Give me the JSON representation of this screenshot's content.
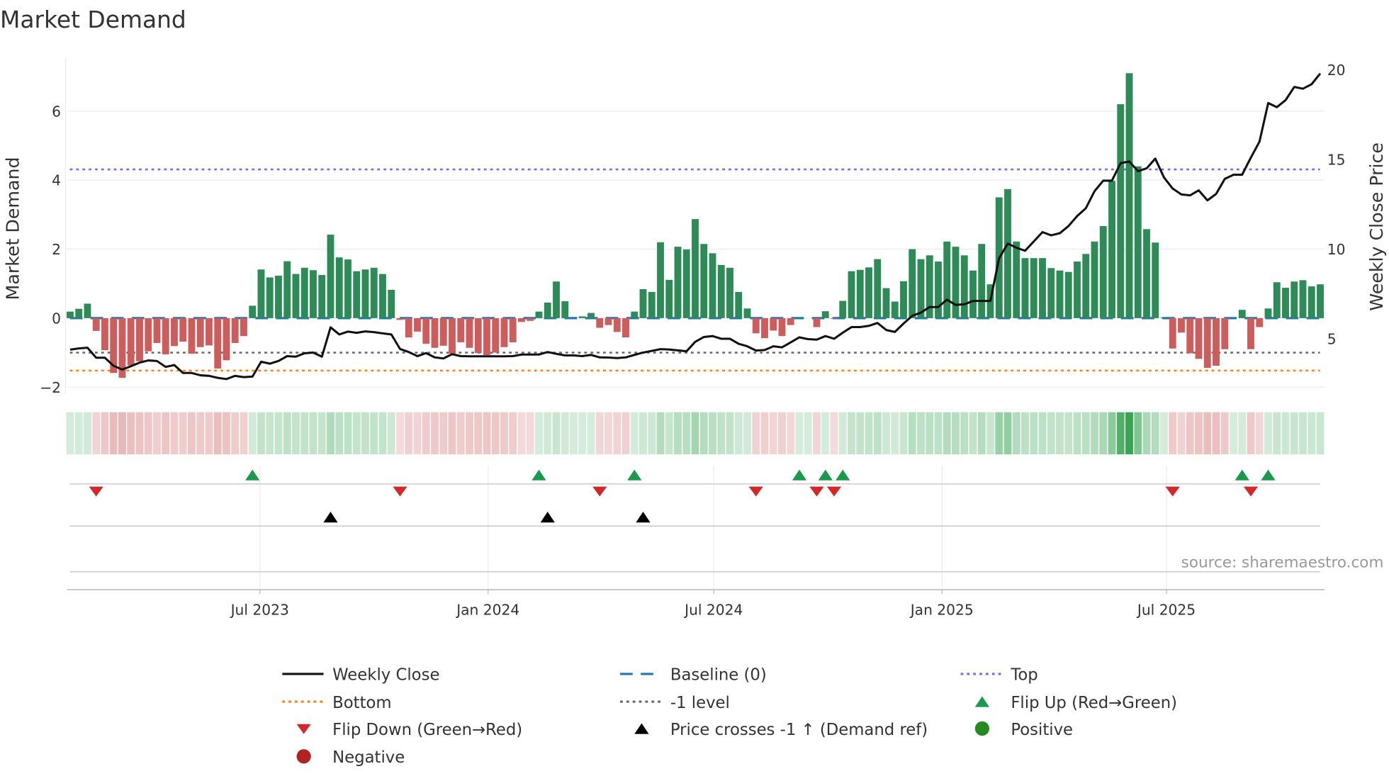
{
  "chart_data": {
    "type": "bar",
    "title": "Market Demand",
    "ylabel": "Market Demand",
    "y2label": "Weekly Close Price",
    "ylim": [
      -2.3,
      7.5
    ],
    "y2lim": [
      2.2,
      21
    ],
    "yticks": [
      "6",
      "4",
      "2",
      "0",
      "−2"
    ],
    "ytick_values": [
      6,
      4,
      2,
      0,
      -2
    ],
    "y2ticks": [
      "20",
      "15",
      "10",
      "5"
    ],
    "y2tick_values": [
      20,
      15,
      10,
      5
    ],
    "xticks": [
      {
        "label": "Jul 2023",
        "date": "2023-07-01"
      },
      {
        "label": "Jan 2024",
        "date": "2024-01-01"
      },
      {
        "label": "Jul 2024",
        "date": "2024-07-01"
      },
      {
        "label": "Jan 2025",
        "date": "2025-01-01"
      },
      {
        "label": "Jul 2025",
        "date": "2025-07-01"
      }
    ],
    "grid": true,
    "x_start": "2023-01-29",
    "x_step_days": 7,
    "demand": [
      0.19,
      0.27,
      0.42,
      -0.37,
      -0.93,
      -1.59,
      -1.73,
      -1.37,
      -1.25,
      -0.96,
      -0.72,
      -1.05,
      -0.81,
      -0.68,
      -1.03,
      -0.84,
      -0.79,
      -1.46,
      -1.22,
      -0.72,
      -0.52,
      0.36,
      1.41,
      1.18,
      1.23,
      1.65,
      1.28,
      1.46,
      1.39,
      1.25,
      2.42,
      1.76,
      1.7,
      1.36,
      1.41,
      1.46,
      1.28,
      0.82,
      -0.05,
      -0.56,
      -0.39,
      -0.74,
      -0.86,
      -0.8,
      -1.03,
      -0.7,
      -0.86,
      -1.01,
      -1.07,
      -1.0,
      -0.84,
      -0.7,
      -0.11,
      -0.08,
      0.19,
      0.45,
      1.06,
      0.49,
      0,
      0.05,
      0.15,
      -0.28,
      -0.2,
      -0.4,
      -0.56,
      0.19,
      0.84,
      0.76,
      2.2,
      1.11,
      2.07,
      1.99,
      2.87,
      2.15,
      1.88,
      1.54,
      1.46,
      0.76,
      0.28,
      -0.44,
      -0.58,
      -0.36,
      -0.52,
      -0.2,
      0.02,
      0,
      -0.26,
      0.2,
      -0.02,
      0.5,
      1.36,
      1.4,
      1.47,
      1.71,
      0.87,
      0.48,
      1.07,
      2.0,
      1.71,
      1.82,
      1.64,
      2.22,
      2.07,
      1.82,
      1.38,
      2.15,
      0.98,
      3.5,
      3.74,
      2.22,
      1.74,
      1.74,
      1.74,
      1.45,
      1.38,
      1.34,
      1.64,
      1.86,
      2.22,
      2.67,
      3.98,
      6.2,
      7.1,
      4.4,
      2.58,
      2.19,
      0.02,
      -0.88,
      -0.42,
      -1.02,
      -1.18,
      -1.44,
      -1.38,
      -0.9,
      0,
      0.24,
      -0.9,
      -0.26,
      0.28,
      1.04,
      0.88,
      1.06,
      1.1,
      0.92,
      0.98
    ],
    "weekly_close": [
      4.39,
      4.46,
      4.5,
      3.94,
      3.94,
      3.49,
      3.28,
      3.47,
      3.67,
      3.79,
      3.76,
      3.43,
      3.53,
      3.09,
      3.09,
      2.96,
      2.93,
      2.82,
      2.75,
      2.93,
      2.86,
      2.89,
      3.72,
      3.61,
      3.76,
      4.03,
      4.0,
      4.19,
      4.23,
      4.0,
      5.64,
      5.24,
      5.4,
      5.33,
      5.41,
      5.37,
      5.3,
      5.24,
      4.43,
      4.26,
      4.03,
      4.2,
      3.96,
      3.9,
      4.14,
      4.03,
      4.02,
      4.02,
      4.02,
      4.02,
      4.02,
      4.03,
      4.12,
      4.12,
      4.12,
      4.26,
      4.16,
      4.07,
      4.07,
      4.03,
      4.1,
      3.96,
      3.95,
      3.92,
      3.96,
      4.1,
      4.23,
      4.32,
      4.42,
      4.4,
      4.35,
      4.3,
      4.83,
      5.1,
      5.15,
      5.0,
      5.0,
      4.72,
      4.58,
      4.34,
      4.37,
      4.58,
      4.52,
      4.8,
      5.08,
      4.98,
      4.95,
      5.15,
      5.0,
      5.34,
      5.65,
      5.65,
      5.72,
      5.88,
      5.49,
      5.38,
      5.85,
      6.28,
      6.46,
      6.77,
      6.77,
      7.18,
      6.89,
      6.92,
      7.11,
      7.11,
      7.11,
      9.49,
      10.31,
      10.08,
      9.91,
      10.43,
      10.95,
      10.77,
      10.89,
      11.29,
      11.85,
      12.28,
      13.23,
      13.82,
      13.82,
      14.8,
      14.89,
      14.35,
      14.51,
      15.05,
      14.0,
      13.38,
      13.05,
      13.0,
      13.28,
      12.72,
      13.08,
      13.92,
      14.15,
      14.15,
      15.1,
      16.0,
      18.15,
      17.92,
      18.31,
      19.05,
      18.95,
      19.2,
      19.8
    ],
    "levels": {
      "top": 4.31,
      "bottom": -1.52,
      "minus_one": -1,
      "baseline": 0
    },
    "flip_up_weeks": [
      21,
      54,
      65,
      84,
      87,
      89,
      135,
      138
    ],
    "flip_down_weeks": [
      3,
      38,
      61,
      79,
      86,
      88,
      127,
      136
    ],
    "price_cross_weeks": [
      30,
      55,
      66
    ],
    "legend": [
      {
        "label": "Weekly Close",
        "symbol": "solid-line",
        "color": "#111111"
      },
      {
        "label": "Baseline (0)",
        "symbol": "dashed-line",
        "color": "#1f77b4"
      },
      {
        "label": "Top",
        "symbol": "dotted-line",
        "color": "#7b68ee"
      },
      {
        "label": "Bottom",
        "symbol": "dotted-line",
        "color": "#ff7f0e"
      },
      {
        "label": "-1 level",
        "symbol": "dotted-line",
        "color": "#666666"
      },
      {
        "label": "Flip Up (Red→Green)",
        "symbol": "triangle-up",
        "color": "#1a9a4a"
      },
      {
        "label": "Flip Down (Green→Red)",
        "symbol": "triangle-down",
        "color": "#d62728"
      },
      {
        "label": "Price crosses -1 ↑ (Demand ref)",
        "symbol": "triangle-up",
        "color": "#000000"
      },
      {
        "label": "Positive",
        "symbol": "circle",
        "color": "#228b22"
      },
      {
        "label": "Negative",
        "symbol": "circle",
        "color": "#b22222"
      }
    ],
    "legend_position": "bottom"
  },
  "colors": {
    "positive_bar": "#2e8b57",
    "negative_bar": "#cd5c5c",
    "price": "#111111"
  },
  "source": "source: sharemaestro.com"
}
